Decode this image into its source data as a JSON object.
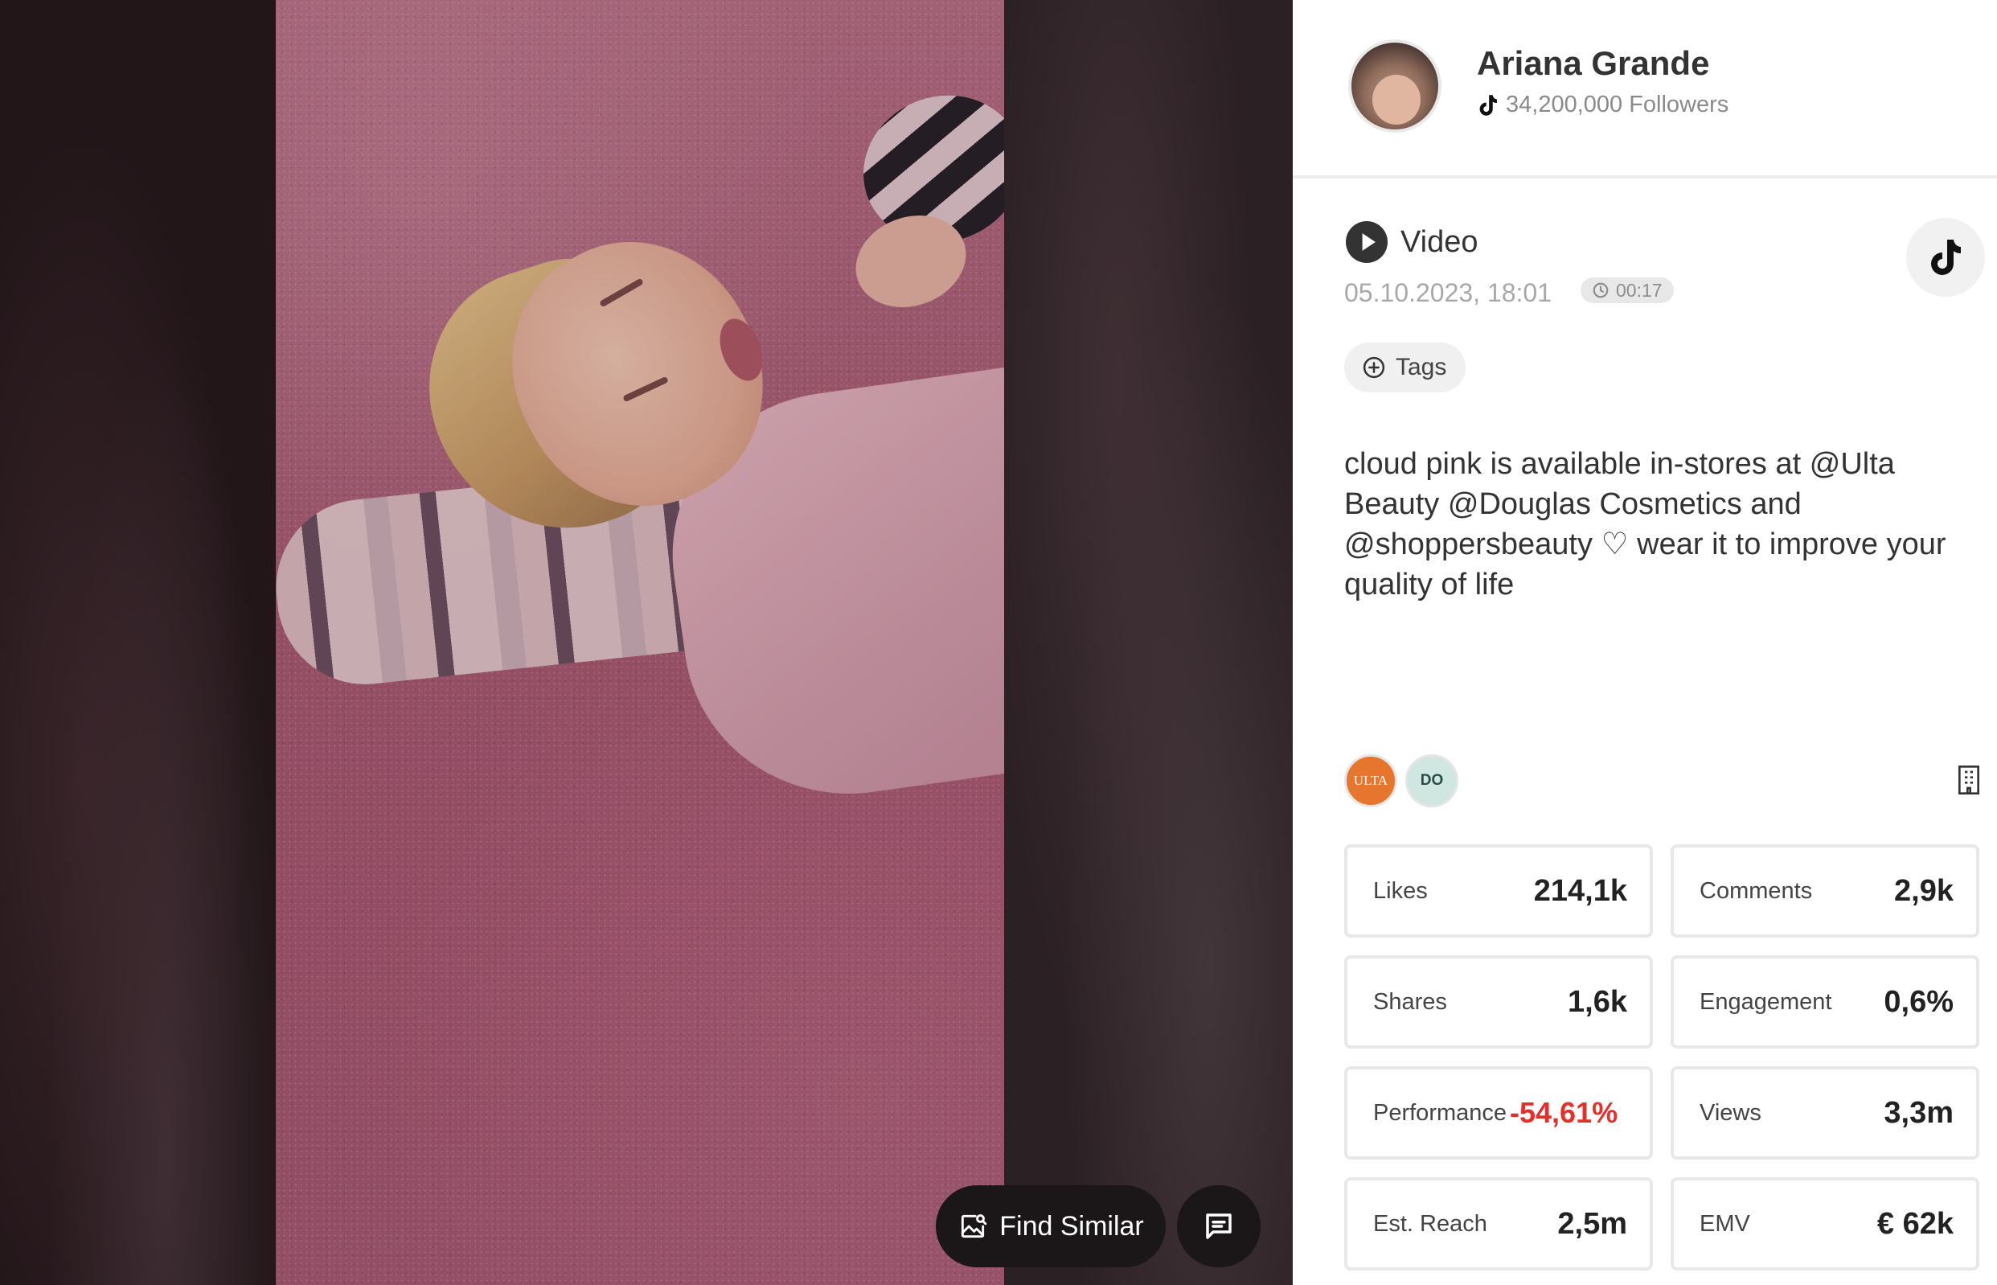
{
  "profile": {
    "name": "Ariana Grande",
    "followers": "34,200,000 Followers"
  },
  "post": {
    "type": "Video",
    "date": "05.10.2023, 18:01",
    "duration": "00:17",
    "tags_label": "Tags",
    "caption": "cloud pink is available in-stores at @Ulta Beauty @Douglas Cosmetics and @shoppersbeauty ♡ wear it to improve your quality of life",
    "brands": [
      "ULTA",
      "DO"
    ]
  },
  "stats": [
    {
      "label": "Likes",
      "value": "214,1k"
    },
    {
      "label": "Comments",
      "value": "2,9k"
    },
    {
      "label": "Shares",
      "value": "1,6k"
    },
    {
      "label": "Engagement",
      "value": "0,6%"
    },
    {
      "label": "Performance",
      "value": "-54,61%"
    },
    {
      "label": "Views",
      "value": "3,3m"
    },
    {
      "label": "Est. Reach",
      "value": "2,5m"
    },
    {
      "label": "EMV",
      "value": "€ 62k"
    }
  ],
  "viewer": {
    "find_similar_label": "Find Similar"
  },
  "icons": {
    "platform": "tiktok-icon",
    "play": "play-icon",
    "clock": "clock-icon",
    "add": "plus-circle-icon",
    "chat": "chat-icon",
    "image_search": "image-search-icon",
    "building": "building-icon"
  },
  "colors": {
    "negative": "#e0322d",
    "button_dark": "#1b1618"
  }
}
